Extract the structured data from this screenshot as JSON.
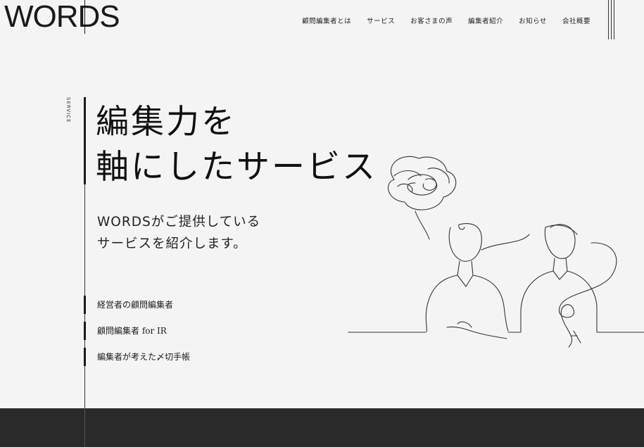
{
  "header": {
    "logo": "WORDS",
    "nav": [
      {
        "label": "顧問編集者とは"
      },
      {
        "label": "サービス"
      },
      {
        "label": "お客さまの声"
      },
      {
        "label": "編集者紹介"
      },
      {
        "label": "お知らせ"
      },
      {
        "label": "会社概要"
      }
    ],
    "menu_icon": "hamburger-lines-icon"
  },
  "hero": {
    "section_label": "SERVICE",
    "headline_line1": "編集力を",
    "headline_line2": "軸にしたサービス",
    "lead_line1": "WORDSがご提供している",
    "lead_line2": "サービスを紹介します。"
  },
  "services": [
    {
      "label": "経営者の顧問編集者"
    },
    {
      "label": "顧問編集者 for IR"
    },
    {
      "label": "編集者が考えた〆切手帳"
    }
  ],
  "illustration": {
    "icon": "two-people-conversation-line-art"
  },
  "colors": {
    "background": "#f4f4f4",
    "text": "#1a1a1a",
    "footer": "#2a2a2a"
  }
}
